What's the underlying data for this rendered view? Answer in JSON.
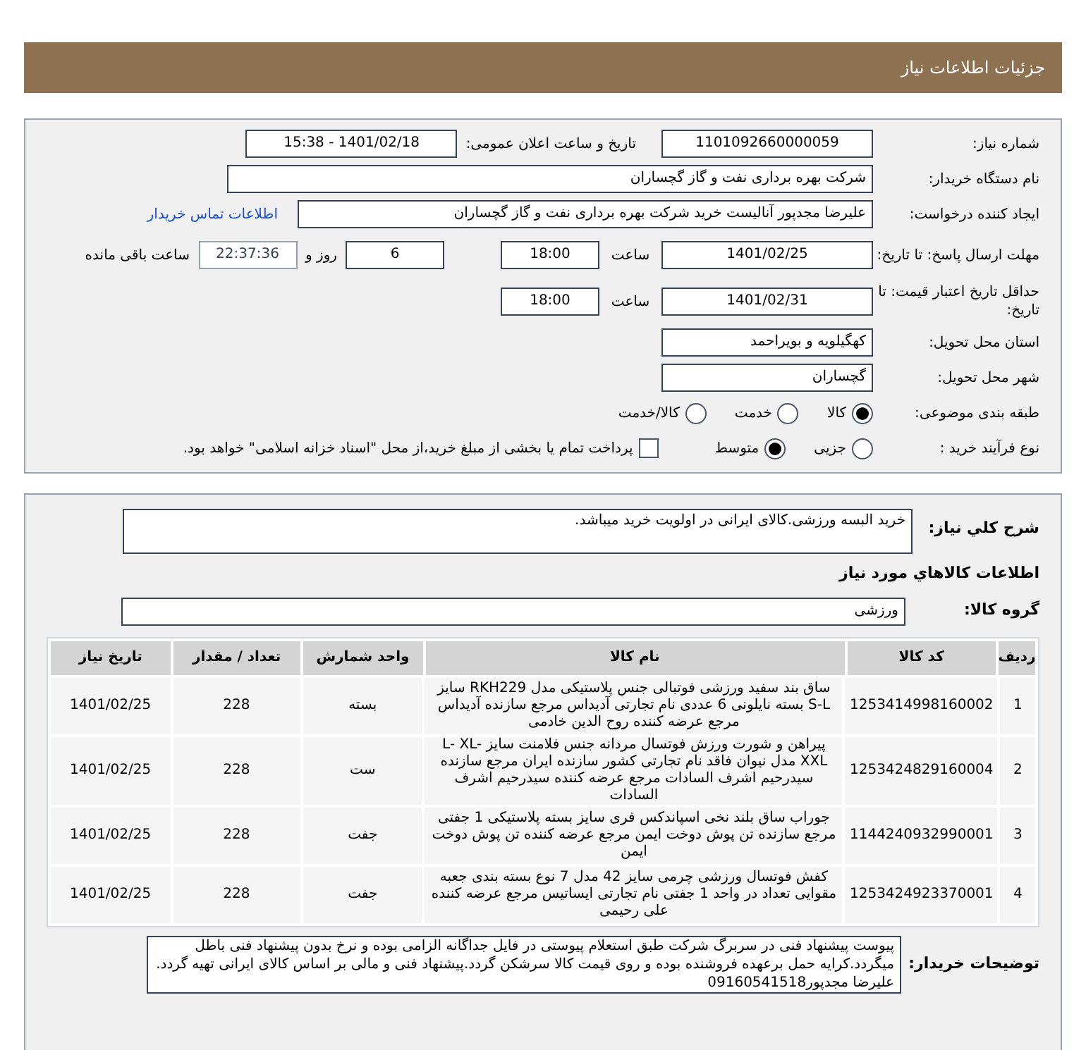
{
  "header": {
    "title": "جزئیات اطلاعات نیاز"
  },
  "need_number": {
    "label": "شماره نیاز:",
    "value": "1101092660000059"
  },
  "announce_datetime": {
    "label": "تاریخ و ساعت اعلان عمومی:",
    "value": "1401/02/18 - 15:38"
  },
  "buyer_org": {
    "label": "نام دستگاه خریدار:",
    "value": "شرکت بهره برداری نفت و گاز گچساران"
  },
  "requester": {
    "label": "ایجاد کننده درخواست:",
    "value": "علیرضا مجدپور آنالیست خرید شرکت بهره برداری نفت و گاز گچساران",
    "contact_link": "اطلاعات تماس خریدار"
  },
  "response_deadline": {
    "label": "مهلت ارسال پاسخ: تا تاریخ:",
    "date": "1401/02/25",
    "time_label": "ساعت",
    "time": "18:00",
    "days": "6",
    "days_label": "روز و",
    "remaining": "22:37:36",
    "remaining_label": "ساعت باقی مانده"
  },
  "price_validity": {
    "label": "حداقل تاریخ اعتبار قیمت: تا تاریخ:",
    "date": "1401/02/31",
    "time_label": "ساعت",
    "time": "18:00"
  },
  "delivery_province": {
    "label": "استان محل تحویل:",
    "value": "کهگیلویه و بویراحمد"
  },
  "delivery_city": {
    "label": "شهر محل تحویل:",
    "value": "گچساران"
  },
  "subject_category": {
    "label": "طبقه بندی موضوعی:",
    "options": [
      {
        "label": "کالا",
        "selected": true
      },
      {
        "label": "خدمت",
        "selected": false
      },
      {
        "label": "کالا/خدمت",
        "selected": false
      }
    ]
  },
  "purchase_process": {
    "label": "نوع فرآیند خرید :",
    "options": [
      {
        "label": "جزیی",
        "selected": false
      },
      {
        "label": "متوسط",
        "selected": true
      }
    ],
    "payment_option": {
      "label": "پرداخت تمام یا بخشی از مبلغ خرید،از محل \"اسناد خزانه اسلامی\" خواهد بود.",
      "checked": false
    }
  },
  "description": {
    "label": "شرح کلي نياز:",
    "value": "خرید البسه ورزشی.کالای ایرانی در اولویت خرید میباشد."
  },
  "goods_section_title": "اطلاعات کالاهاي مورد نياز",
  "goods_group": {
    "label": "گروه کالا:",
    "value": "ورزشی"
  },
  "table": {
    "columns": [
      "ردیف",
      "کد کالا",
      "نام کالا",
      "واحد شمارش",
      "تعداد / مقدار",
      "تاریخ نیاز"
    ],
    "rows": [
      {
        "cells": [
          "1",
          "1253414998160002",
          "ساق بند سفید ورزشی فوتبالی جنس پلاستیکی مدل RKH229 سایز S-L بسته نایلونی 6 عددی نام تجارتی آدیداس مرجع سازنده آدیداس مرجع عرضه کننده روح الدین خادمی",
          "بسته",
          "228",
          "1401/02/25"
        ]
      },
      {
        "cells": [
          "2",
          "1253424829160004",
          "پیراهن و شورت ورزش فوتسال مردانه جنس فلامنت سایز L- XL-XXL مدل نیوان فاقد نام تجارتی کشور سازنده ایران مرجع سازنده سیدرحیم اشرف السادات مرجع عرضه کننده سیدرحیم اشرف السادات",
          "ست",
          "228",
          "1401/02/25"
        ]
      },
      {
        "cells": [
          "3",
          "1144240932990001",
          "جوراب ساق بلند نخی اسپاندکس فری سایز بسته پلاستیکی 1 جفتی مرجع سازنده تن پوش دوخت ایمن مرجع عرضه کننده تن پوش دوخت ایمن",
          "جفت",
          "228",
          "1401/02/25"
        ]
      },
      {
        "cells": [
          "4",
          "1253424923370001",
          "کفش فوتسال ورزشی چرمی سایز 42 مدل 7 نوع بسته بندی جعبه مقوایی تعداد در واحد 1 جفتی نام تجارتی ایساتیس مرجع عرضه کننده علی رحیمی",
          "جفت",
          "228",
          "1401/02/25"
        ]
      }
    ]
  },
  "buyer_notes": {
    "label": "توضیحات خریدار:",
    "value": "پیوست پیشنهاد فنی در سربرگ شرکت طبق استعلام پیوستی در فایل جداگانه الزامی بوده و نرخ بدون پیشنهاد فنی باطل میگردد.کرایه حمل برعهده فروشنده بوده و روی قیمت کالا سرشکن گردد.پیشنهاد فنی و مالی بر اساس کالای ایرانی تهیه گردد. علیرضا مجدپور09160541518"
  }
}
